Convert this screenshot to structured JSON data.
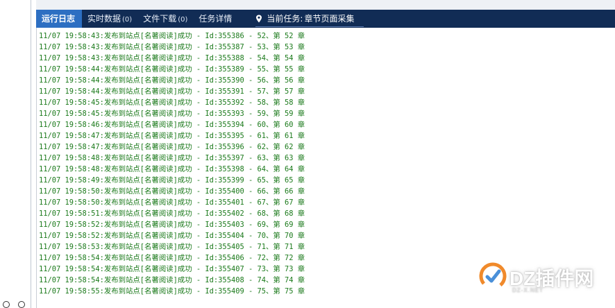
{
  "tabs": [
    {
      "label": "运行日志",
      "count": "",
      "active": true
    },
    {
      "label": "实时数据",
      "count": "(0)",
      "active": false
    },
    {
      "label": "文件下载",
      "count": "(0)",
      "active": false
    },
    {
      "label": "任务详情",
      "count": "",
      "active": false
    }
  ],
  "current_task": {
    "label": "当前任务:",
    "value": "章节页面采集"
  },
  "log": [
    "11/07 19:58:43:发布到站点[名著阅读]成功 - Id:355386 - 52、第 52 章",
    "11/07 19:58:43:发布到站点[名著阅读]成功 - Id:355387 - 53、第 53 章",
    "11/07 19:58:43:发布到站点[名著阅读]成功 - Id:355388 - 54、第 54 章",
    "11/07 19:58:44:发布到站点[名著阅读]成功 - Id:355389 - 55、第 55 章",
    "11/07 19:58:44:发布到站点[名著阅读]成功 - Id:355390 - 56、第 56 章",
    "11/07 19:58:44:发布到站点[名著阅读]成功 - Id:355391 - 57、第 57 章",
    "11/07 19:58:45:发布到站点[名著阅读]成功 - Id:355392 - 58、第 58 章",
    "11/07 19:58:45:发布到站点[名著阅读]成功 - Id:355393 - 59、第 59 章",
    "11/07 19:58:46:发布到站点[名著阅读]成功 - Id:355394 - 60、第 60 章",
    "11/07 19:58:47:发布到站点[名著阅读]成功 - Id:355395 - 61、第 61 章",
    "11/07 19:58:47:发布到站点[名著阅读]成功 - Id:355396 - 62、第 62 章",
    "11/07 19:58:48:发布到站点[名著阅读]成功 - Id:355397 - 63、第 63 章",
    "11/07 19:58:48:发布到站点[名著阅读]成功 - Id:355398 - 64、第 64 章",
    "11/07 19:58:49:发布到站点[名著阅读]成功 - Id:355399 - 65、第 65 章",
    "11/07 19:58:50:发布到站点[名著阅读]成功 - Id:355400 - 66、第 66 章",
    "11/07 19:58:50:发布到站点[名著阅读]成功 - Id:355401 - 67、第 67 章",
    "11/07 19:58:51:发布到站点[名著阅读]成功 - Id:355402 - 68、第 68 章",
    "11/07 19:58:52:发布到站点[名著阅读]成功 - Id:355403 - 69、第 69 章",
    "11/07 19:58:52:发布到站点[名著阅读]成功 - Id:355404 - 70、第 70 章",
    "11/07 19:58:53:发布到站点[名著阅读]成功 - Id:355405 - 71、第 71 章",
    "11/07 19:58:54:发布到站点[名著阅读]成功 - Id:355406 - 72、第 72 章",
    "11/07 19:58:54:发布到站点[名著阅读]成功 - Id:355407 - 73、第 73 章",
    "11/07 19:58:54:发布到站点[名著阅读]成功 - Id:355408 - 74、第 74 章",
    "11/07 19:58:55:发布到站点[名著阅读]成功 - Id:355409 - 75、第 75 章"
  ],
  "watermark": {
    "text": "DZ插件网",
    "sub": "DZ-X.NET"
  },
  "colors": {
    "tabbar_bg": "#112c55",
    "active_tab_bg": "#2d6fc2",
    "log_text": "#1b7a1b"
  },
  "icons": {
    "location": "map-pin-icon",
    "watermark_logo": "dz-logo-icon"
  }
}
